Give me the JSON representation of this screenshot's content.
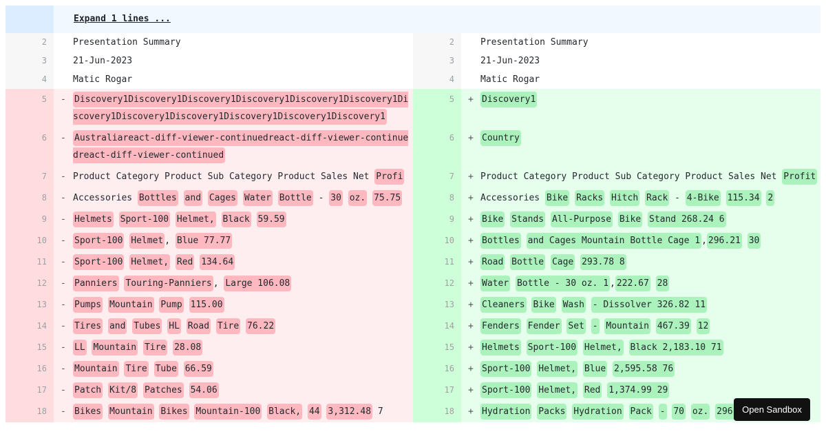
{
  "fold": {
    "label": "Expand 1 lines ..."
  },
  "rows": [
    {
      "type": "plain",
      "h": "h27",
      "left": {
        "n": "2",
        "m": "",
        "words": [
          {
            "t": "Presentation Summary"
          }
        ]
      },
      "right": {
        "n": "2",
        "m": "",
        "words": [
          {
            "t": "Presentation Summary"
          }
        ]
      }
    },
    {
      "type": "plain",
      "h": "h27",
      "left": {
        "n": "3",
        "m": "",
        "words": [
          {
            "t": "21-Jun-2023"
          }
        ]
      },
      "right": {
        "n": "3",
        "m": "",
        "words": [
          {
            "t": "21-Jun-2023"
          }
        ]
      }
    },
    {
      "type": "plain",
      "h": "h27",
      "left": {
        "n": "4",
        "m": "",
        "words": [
          {
            "t": "Matic Rogar"
          }
        ]
      },
      "right": {
        "n": "4",
        "m": "",
        "words": [
          {
            "t": "Matic Rogar"
          }
        ]
      }
    },
    {
      "type": "change",
      "h": "h56",
      "left": {
        "n": "5",
        "m": "-",
        "words": [
          {
            "t": "Discovery1Discovery1Discovery1Discovery1Discovery1Discovery1Discovery1Discovery1Discovery1Discovery1Discovery1Discovery1",
            "hl": true
          }
        ]
      },
      "right": {
        "n": "5",
        "m": "+",
        "words": [
          {
            "t": "Discovery1",
            "hl": true
          }
        ]
      }
    },
    {
      "type": "change",
      "h": "h56",
      "left": {
        "n": "6",
        "m": "-",
        "words": [
          {
            "t": "Australiareact-diff-viewer-continuedreact-diff-viewer-continuedreact-diff-viewer-continued",
            "hl": true
          }
        ]
      },
      "right": {
        "n": "6",
        "m": "+",
        "words": [
          {
            "t": "Country",
            "hl": true
          }
        ]
      }
    },
    {
      "type": "change",
      "h": "h31",
      "left": {
        "n": "7",
        "m": "-",
        "words": [
          {
            "t": "Product Category Product Sub Category Product Sales Net "
          },
          {
            "t": "Profi",
            "hl": true
          }
        ]
      },
      "right": {
        "n": "7",
        "m": "+",
        "words": [
          {
            "t": "Product Category Product Sub Category Product Sales Net "
          },
          {
            "t": "Profit",
            "hl": true
          }
        ]
      }
    },
    {
      "type": "change",
      "h": "h60",
      "left": {
        "n": "8",
        "m": "-",
        "words": [
          {
            "t": "Accessories "
          },
          {
            "t": "Bottles",
            "hl": true
          },
          {
            "t": " "
          },
          {
            "t": "and",
            "hl": true
          },
          {
            "t": " "
          },
          {
            "t": "Cages",
            "hl": true
          },
          {
            "t": " "
          },
          {
            "t": "Water",
            "hl": true
          },
          {
            "t": " "
          },
          {
            "t": "Bottle",
            "hl": true
          },
          {
            "t": " - "
          },
          {
            "t": "30",
            "hl": true
          },
          {
            "t": " "
          },
          {
            "t": "oz.",
            "hl": true
          },
          {
            "t": " "
          },
          {
            "t": "75.75",
            "hl": true
          }
        ]
      },
      "right": {
        "n": "8",
        "m": "+",
        "words": [
          {
            "t": "Accessories "
          },
          {
            "t": "Bike",
            "hl": true
          },
          {
            "t": " "
          },
          {
            "t": "Racks",
            "hl": true
          },
          {
            "t": " "
          },
          {
            "t": "Hitch",
            "hl": true
          },
          {
            "t": " "
          },
          {
            "t": "Rack",
            "hl": true
          },
          {
            "t": " - "
          },
          {
            "t": "4-Bike",
            "hl": true
          },
          {
            "t": " "
          },
          {
            "t": "115.34",
            "hl": true
          },
          {
            "t": " "
          },
          {
            "t": "2",
            "hl": true
          }
        ]
      }
    },
    {
      "type": "change",
      "h": "h31",
      "left": {
        "n": "9",
        "m": "-",
        "words": [
          {
            "t": "Helmets",
            "hl": true
          },
          {
            "t": " "
          },
          {
            "t": "Sport-100",
            "hl": true
          },
          {
            "t": " "
          },
          {
            "t": "Helmet,",
            "hl": true
          },
          {
            "t": " "
          },
          {
            "t": "Black",
            "hl": true
          },
          {
            "t": " "
          },
          {
            "t": "59.59",
            "hl": true
          }
        ]
      },
      "right": {
        "n": "9",
        "m": "+",
        "words": [
          {
            "t": "Bike",
            "hl": true
          },
          {
            "t": " "
          },
          {
            "t": "Stands",
            "hl": true
          },
          {
            "t": " "
          },
          {
            "t": "All-Purpose",
            "hl": true
          },
          {
            "t": " "
          },
          {
            "t": "Bike",
            "hl": true
          },
          {
            "t": " "
          },
          {
            "t": "Stand 268.24 6",
            "hl": true
          }
        ]
      }
    },
    {
      "type": "change",
      "h": "h31",
      "left": {
        "n": "10",
        "m": "-",
        "words": [
          {
            "t": "Sport-100",
            "hl": true
          },
          {
            "t": " "
          },
          {
            "t": "Helmet",
            "hl": true
          },
          {
            "t": ", "
          },
          {
            "t": "Blue 77.77",
            "hl": true
          }
        ]
      },
      "right": {
        "n": "10",
        "m": "+",
        "words": [
          {
            "t": "Bottles",
            "hl": true
          },
          {
            "t": " "
          },
          {
            "t": "and Cages Mountain Bottle Cage 1",
            "hl": true
          },
          {
            "t": ","
          },
          {
            "t": "296.21",
            "hl": true
          },
          {
            "t": " "
          },
          {
            "t": "30",
            "hl": true
          }
        ]
      }
    },
    {
      "type": "change",
      "h": "h31",
      "left": {
        "n": "11",
        "m": "-",
        "words": [
          {
            "t": "Sport-100",
            "hl": true
          },
          {
            "t": " "
          },
          {
            "t": "Helmet,",
            "hl": true
          },
          {
            "t": " "
          },
          {
            "t": "Red",
            "hl": true
          },
          {
            "t": " "
          },
          {
            "t": "134.64",
            "hl": true
          }
        ]
      },
      "right": {
        "n": "11",
        "m": "+",
        "words": [
          {
            "t": "Road",
            "hl": true
          },
          {
            "t": " "
          },
          {
            "t": "Bottle",
            "hl": true
          },
          {
            "t": " "
          },
          {
            "t": "Cage",
            "hl": true
          },
          {
            "t": " "
          },
          {
            "t": "293.78 8",
            "hl": true
          }
        ]
      }
    },
    {
      "type": "change",
      "h": "h31",
      "left": {
        "n": "12",
        "m": "-",
        "words": [
          {
            "t": "Panniers",
            "hl": true
          },
          {
            "t": " "
          },
          {
            "t": "Touring-Panniers",
            "hl": true
          },
          {
            "t": ", "
          },
          {
            "t": "Large 106.08",
            "hl": true
          }
        ]
      },
      "right": {
        "n": "12",
        "m": "+",
        "words": [
          {
            "t": "Water",
            "hl": true
          },
          {
            "t": " "
          },
          {
            "t": "Bottle - 30 oz. 1",
            "hl": true
          },
          {
            "t": ","
          },
          {
            "t": "222.67",
            "hl": true
          },
          {
            "t": " "
          },
          {
            "t": "28",
            "hl": true
          }
        ]
      }
    },
    {
      "type": "change",
      "h": "h31",
      "left": {
        "n": "13",
        "m": "-",
        "words": [
          {
            "t": "Pumps",
            "hl": true
          },
          {
            "t": " "
          },
          {
            "t": "Mountain",
            "hl": true
          },
          {
            "t": " "
          },
          {
            "t": "Pump",
            "hl": true
          },
          {
            "t": " "
          },
          {
            "t": "115.00",
            "hl": true
          }
        ]
      },
      "right": {
        "n": "13",
        "m": "+",
        "words": [
          {
            "t": "Cleaners",
            "hl": true
          },
          {
            "t": " "
          },
          {
            "t": "Bike",
            "hl": true
          },
          {
            "t": " "
          },
          {
            "t": "Wash",
            "hl": true
          },
          {
            "t": " "
          },
          {
            "t": "- Dissolver 326.82 11",
            "hl": true
          }
        ]
      }
    },
    {
      "type": "change",
      "h": "h31",
      "left": {
        "n": "14",
        "m": "-",
        "words": [
          {
            "t": "Tires",
            "hl": true
          },
          {
            "t": " "
          },
          {
            "t": "and",
            "hl": true
          },
          {
            "t": " "
          },
          {
            "t": "Tubes",
            "hl": true
          },
          {
            "t": " "
          },
          {
            "t": "HL",
            "hl": true
          },
          {
            "t": " "
          },
          {
            "t": "Road",
            "hl": true
          },
          {
            "t": " "
          },
          {
            "t": "Tire",
            "hl": true
          },
          {
            "t": " "
          },
          {
            "t": "76.22",
            "hl": true
          }
        ]
      },
      "right": {
        "n": "14",
        "m": "+",
        "words": [
          {
            "t": "Fenders",
            "hl": true
          },
          {
            "t": " "
          },
          {
            "t": "Fender",
            "hl": true
          },
          {
            "t": " "
          },
          {
            "t": "Set",
            "hl": true
          },
          {
            "t": " "
          },
          {
            "t": "-",
            "hl": true
          },
          {
            "t": " "
          },
          {
            "t": "Mountain",
            "hl": true
          },
          {
            "t": " "
          },
          {
            "t": "467.39",
            "hl": true
          },
          {
            "t": " "
          },
          {
            "t": "12",
            "hl": true
          }
        ]
      }
    },
    {
      "type": "change",
      "h": "h31",
      "left": {
        "n": "15",
        "m": "-",
        "words": [
          {
            "t": "LL",
            "hl": true
          },
          {
            "t": " "
          },
          {
            "t": "Mountain",
            "hl": true
          },
          {
            "t": " "
          },
          {
            "t": "Tire",
            "hl": true
          },
          {
            "t": " "
          },
          {
            "t": "28.08",
            "hl": true
          }
        ]
      },
      "right": {
        "n": "15",
        "m": "+",
        "words": [
          {
            "t": "Helmets",
            "hl": true
          },
          {
            "t": " "
          },
          {
            "t": "Sport-100",
            "hl": true
          },
          {
            "t": " "
          },
          {
            "t": "Helmet,",
            "hl": true
          },
          {
            "t": " "
          },
          {
            "t": "Black 2,183.10 71",
            "hl": true
          }
        ]
      }
    },
    {
      "type": "change",
      "h": "h31",
      "left": {
        "n": "16",
        "m": "-",
        "words": [
          {
            "t": "Mountain",
            "hl": true
          },
          {
            "t": " "
          },
          {
            "t": "Tire",
            "hl": true
          },
          {
            "t": " "
          },
          {
            "t": "Tube",
            "hl": true
          },
          {
            "t": " "
          },
          {
            "t": "66.59",
            "hl": true
          }
        ]
      },
      "right": {
        "n": "16",
        "m": "+",
        "words": [
          {
            "t": "Sport-100",
            "hl": true
          },
          {
            "t": " "
          },
          {
            "t": "Helmet,",
            "hl": true
          },
          {
            "t": " "
          },
          {
            "t": "Blue",
            "hl": true
          },
          {
            "t": " "
          },
          {
            "t": "2,595.58 76",
            "hl": true
          }
        ]
      }
    },
    {
      "type": "change",
      "h": "h31",
      "left": {
        "n": "17",
        "m": "-",
        "words": [
          {
            "t": "Patch",
            "hl": true
          },
          {
            "t": " "
          },
          {
            "t": "Kit/8",
            "hl": true
          },
          {
            "t": " "
          },
          {
            "t": "Patches",
            "hl": true
          },
          {
            "t": " "
          },
          {
            "t": "54.06",
            "hl": true
          }
        ]
      },
      "right": {
        "n": "17",
        "m": "+",
        "words": [
          {
            "t": "Sport-100",
            "hl": true
          },
          {
            "t": " "
          },
          {
            "t": "Helmet,",
            "hl": true
          },
          {
            "t": " "
          },
          {
            "t": "Red",
            "hl": true
          },
          {
            "t": " "
          },
          {
            "t": "1,374.99 29",
            "hl": true
          }
        ]
      }
    },
    {
      "type": "change",
      "h": "h31",
      "left": {
        "n": "18",
        "m": "-",
        "words": [
          {
            "t": "Bikes",
            "hl": true
          },
          {
            "t": " "
          },
          {
            "t": "Mountain",
            "hl": true
          },
          {
            "t": " "
          },
          {
            "t": "Bikes",
            "hl": true
          },
          {
            "t": " "
          },
          {
            "t": "Mountain-100",
            "hl": true
          },
          {
            "t": " "
          },
          {
            "t": "Black,",
            "hl": true
          },
          {
            "t": " "
          },
          {
            "t": "44",
            "hl": true
          },
          {
            "t": " "
          },
          {
            "t": "3,312.48",
            "hl": true
          },
          {
            "t": " 7"
          }
        ]
      },
      "right": {
        "n": "18",
        "m": "+",
        "words": [
          {
            "t": "Hydration",
            "hl": true
          },
          {
            "t": " "
          },
          {
            "t": "Packs",
            "hl": true
          },
          {
            "t": " "
          },
          {
            "t": "Hydration",
            "hl": true
          },
          {
            "t": " "
          },
          {
            "t": "Pack",
            "hl": true
          },
          {
            "t": " "
          },
          {
            "t": "-",
            "hl": true
          },
          {
            "t": " "
          },
          {
            "t": "70",
            "hl": true
          },
          {
            "t": " "
          },
          {
            "t": "oz.",
            "hl": true
          },
          {
            "t": " "
          },
          {
            "t": "296.97",
            "hl": true
          },
          {
            "t": " 7"
          }
        ]
      }
    }
  ],
  "sandbox": {
    "label": "Open Sandbox"
  }
}
